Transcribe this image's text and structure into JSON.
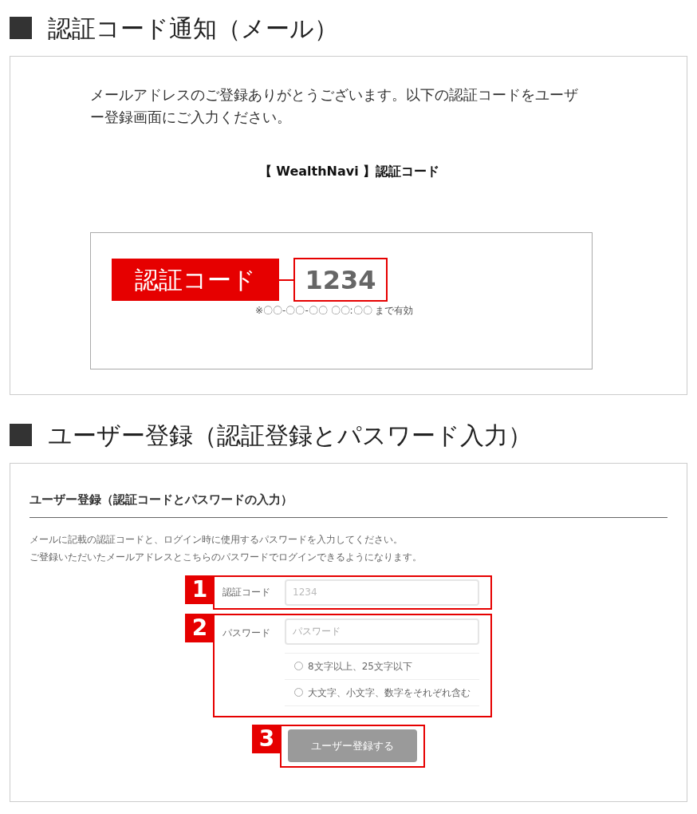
{
  "email_section": {
    "heading": "認証コード通知（メール）",
    "message": "メールアドレスのご登録ありがとうございます。以下の認証コードをユーザー登録画面にご入力ください。",
    "subject": "【 WealthNavi 】認証コード",
    "code_label": "認証コード",
    "code": "1234",
    "validity": "※〇〇-〇〇-〇〇 〇〇:〇〇 まで有効"
  },
  "register_section": {
    "heading": "ユーザー登録（認証登録とパスワード入力）",
    "form_title": "ユーザー登録（認証コードとパスワードの入力）",
    "instructions": [
      "メールに記載の認証コードと、ログイン時に使用するパスワードを入力してください。",
      "ご登録いただいたメールアドレスとこちらのパスワードでログインできるようになります。"
    ],
    "fields": [
      {
        "marker": "1",
        "label": "認証コード",
        "placeholder": "1234"
      },
      {
        "marker": "2",
        "label": "パスワード",
        "placeholder": "パスワード"
      }
    ],
    "requirements": [
      {
        "text": "8文字以上、25文字以下",
        "met": false
      },
      {
        "text": "大文字、小文字、数字をそれぞれ含む",
        "met": false
      }
    ],
    "button": {
      "marker": "3",
      "label": "ユーザー登録する",
      "disabled": true
    }
  }
}
